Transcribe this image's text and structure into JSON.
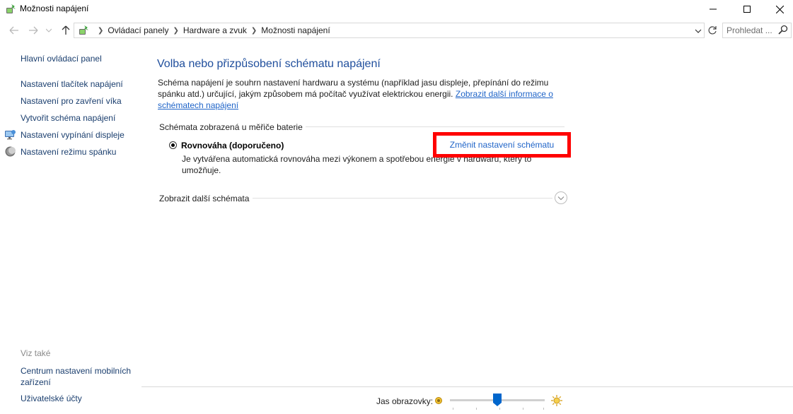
{
  "window": {
    "title": "Možnosti napájení"
  },
  "address_bar": {
    "breadcrumbs": [
      "Ovládací panely",
      "Hardware a zvuk",
      "Možnosti napájení"
    ],
    "search_placeholder": "Prohledat ..."
  },
  "sidebar": {
    "items": [
      {
        "label": "Hlavní ovládací panel",
        "icon": ""
      },
      {
        "label": "Nastavení tlačítek napájení",
        "icon": ""
      },
      {
        "label": "Nastavení pro zavření víka",
        "icon": ""
      },
      {
        "label": "Vytvořit schéma napájení",
        "icon": ""
      },
      {
        "label": "Nastavení vypínání displeje",
        "icon": "display-icon"
      },
      {
        "label": "Nastavení režimu spánku",
        "icon": "moon-icon"
      }
    ],
    "see_also_label": "Viz také",
    "see_also_items": [
      {
        "label_line1": "Centrum nastavení mobilních",
        "label_line2": "zařízení"
      },
      {
        "label_line1": "Uživatelské účty"
      }
    ]
  },
  "main": {
    "heading": "Volba nebo přizpůsobení schématu napájení",
    "description_text": "Schéma napájení je souhrn nastavení hardwaru a systému (například jasu displeje, přepínání do režimu spánku atd.) určující, jakým způsobem má počítač využívat elektrickou energii.",
    "description_link": "Zobrazit další informace o schématech napájení",
    "section_label": "Schémata zobrazená u měřiče baterie",
    "plan": {
      "name": "Rovnováha (doporučeno)",
      "selected": true,
      "description": "Je vytvářena automatická rovnováha mezi výkonem a spotřebou energie v hardwaru, který to umožňuje.",
      "change_link": "Změnit nastavení schématu"
    },
    "more_plans_label": "Zobrazit další schémata"
  },
  "bottom": {
    "brightness_label": "Jas obrazovky:",
    "brightness_level": 0.5
  },
  "colors": {
    "accent_link": "#1f64c8",
    "heading": "#1f4e9c",
    "highlight_box": "#ff0000",
    "slider_thumb": "#0066cc"
  }
}
